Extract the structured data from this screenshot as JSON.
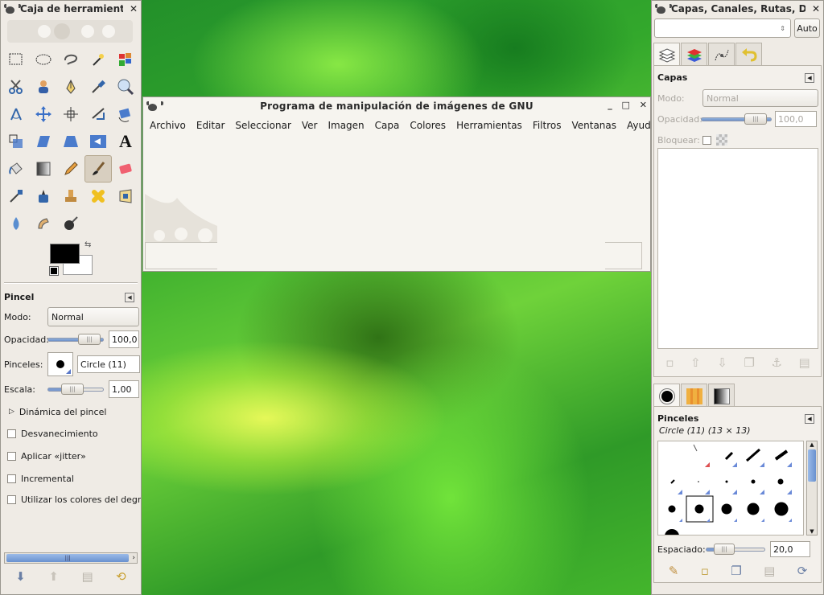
{
  "toolbox": {
    "title": "Caja de herramientas",
    "tool_options": {
      "title": "Pincel",
      "mode_label": "Modo:",
      "mode_value": "Normal",
      "opacity_label": "Opacidad:",
      "opacity_value": "100,0",
      "opacity_level": 0.9,
      "brushes_label": "Pinceles:",
      "brush_name": "Circle (11)",
      "scale_label": "Escala:",
      "scale_value": "1,00",
      "scale_level": 0.4,
      "dynamics": "Dinámica del pincel",
      "fade": "Desvanecimiento",
      "jitter": "Aplicar «jitter»",
      "incremental": "Incremental",
      "gradient_colors": "Utilizar los colores del degrad"
    }
  },
  "tools": [
    "rect-select",
    "ellipse-select",
    "free-select",
    "fuzzy-select",
    "select-by-color",
    "scissors",
    "foreground-select",
    "paths",
    "color-picker",
    "zoom",
    "measure",
    "move",
    "align",
    "crop",
    "rotate",
    "scale",
    "shear",
    "perspective",
    "flip",
    "text",
    "bucket-fill",
    "blend",
    "pencil",
    "paintbrush",
    "eraser",
    "airbrush",
    "ink",
    "clone",
    "heal",
    "perspective-clone",
    "blur",
    "smudge",
    "dodge-burn"
  ],
  "text_tool_glyph": "A",
  "main": {
    "title": "Programa de manipulación de imágenes de GNU",
    "menus": [
      "Archivo",
      "Editar",
      "Seleccionar",
      "Ver",
      "Imagen",
      "Capa",
      "Colores",
      "Herramientas",
      "Filtros",
      "Ventanas",
      "Ayuda"
    ],
    "min": "_",
    "max": "□",
    "close": "✕"
  },
  "dock": {
    "title": "Capas, Canales, Rutas, De",
    "auto_button": "Auto",
    "layers": {
      "title": "Capas",
      "mode_label": "Modo:",
      "mode_value": "Normal",
      "opacity_label": "Opacidad:",
      "opacity_value": "100,0",
      "opacity_level": 0.9,
      "lock_label": "Bloquear:"
    },
    "brushes": {
      "title": "Pinceles",
      "current": "Circle (11) (13 × 13)",
      "spacing_label": "Espaciado:",
      "spacing_value": "20,0",
      "spacing_level": 0.2
    }
  },
  "close": "✕"
}
